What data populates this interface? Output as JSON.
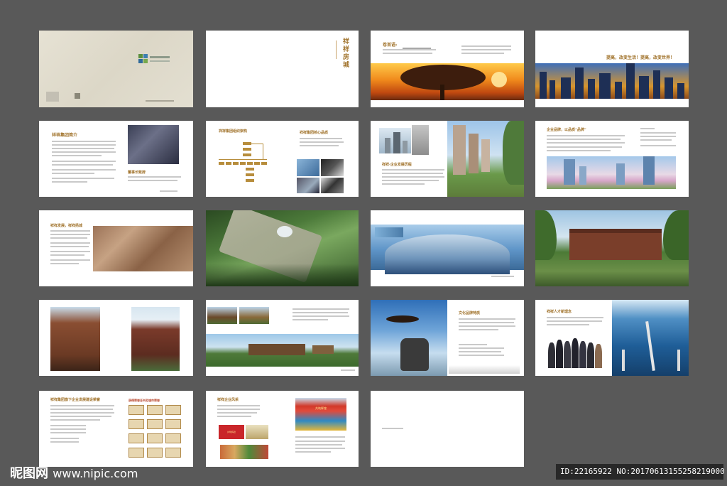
{
  "brochure": {
    "p2_vertical_title": "祥祥房城",
    "p3_heading": "卷首语:",
    "p4_slogan": "提高，改变生活！提高，改变世界！",
    "p5_heading": "祥祥集团简介",
    "p5_side_heading": "董事长致辞",
    "p6_heading": "祥祥集团组织架构",
    "p6_side_heading": "祥祥集团核心品质",
    "p7_heading": "祥祥·企业发展历程",
    "p8_heading": "企业品牌，以品质“品牌”",
    "p9_heading": "祥祥发展，祥祥扬城",
    "p15_heading": "文化品牌特质",
    "p16_heading": "祥祥人才新理念",
    "p17_heading": "祥祥集团旗下企业发展建设荣誉",
    "p17_side_heading": "获得荣誉证书及城市荣誉",
    "p18_heading": "祥祥企业风采",
    "p18_banner": "共筑辉煌",
    "p18_sign": "共筑辉煌"
  },
  "watermark": {
    "brand": "昵图网",
    "url": "www.nipic.com"
  },
  "image_id": "ID:22165922 NO:20170613155258219000",
  "colors": {
    "background": "#595959",
    "accent_gold": "#a0722a"
  }
}
